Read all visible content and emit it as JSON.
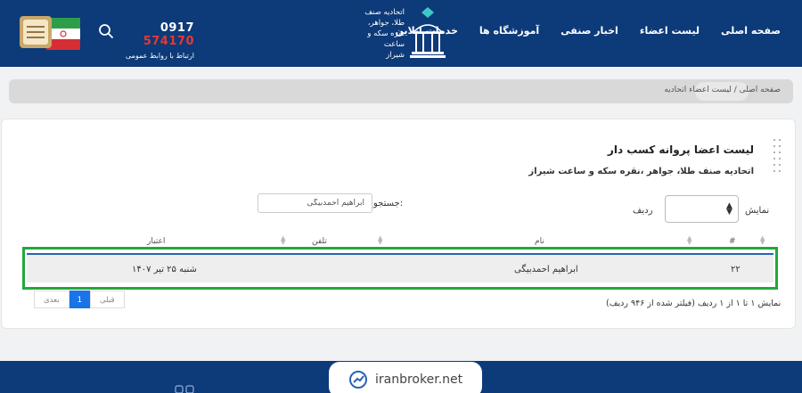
{
  "header": {
    "nav": [
      "صفحه اصلی",
      "لیست اعضاء",
      "اخبار صنفی",
      "آموزشگاه ها",
      "خدمات انلاین"
    ],
    "logo_lines": [
      "اتحادیه صنف",
      "طلا، جواهر،",
      "نقره سکه و ساعت",
      "شیراز"
    ],
    "phone_prefix": "0917",
    "phone_number": "574170",
    "contact_label": "ارتباط با روابط عمومی"
  },
  "breadcrumb": {
    "text": "صفحه اصلی / لیست اعضاء اتحادیه"
  },
  "card": {
    "title": "لیست اعضا پروانه کسب دار",
    "subtitle": "اتحادیه صنف طلا، جواهر ،نقره سکه و ساعت شیراز",
    "show_label": "نمایش",
    "row_label": "ردیف",
    "search_label": "جستجو:",
    "search_value": "ابراهیم احمدبیگی",
    "columns": [
      "#",
      "نام",
      "تلفن",
      "اعتبار"
    ],
    "rows": [
      {
        "num": "۲۲",
        "name": "ابراهیم احمدبیگی",
        "phone": "",
        "validity": "شنبه ۲۵ تیر ۱۴۰۷"
      }
    ],
    "info": "نمایش ۱ تا ۱ از ۱ ردیف (فیلتر شده از ۹۴۶ ردیف)",
    "pager": {
      "prev": "قبلی",
      "current": "1",
      "next": "بعدی"
    }
  },
  "watermark": "iranbroker.net",
  "colors": {
    "header": "#0d3a78",
    "accent": "#1a73e8",
    "highlight": "#22a83a",
    "phone_highlight": "#e53935"
  }
}
